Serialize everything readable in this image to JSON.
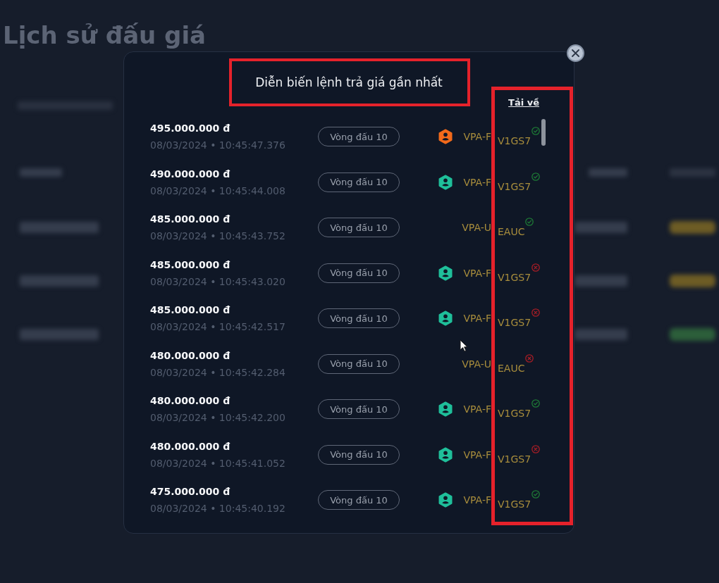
{
  "page": {
    "title": "Lịch sử đấu giá",
    "status_badges": [
      {
        "color": "#6d5c25"
      },
      {
        "color": "#6d5c25"
      },
      {
        "color": "#2c5e3a"
      }
    ]
  },
  "modal": {
    "title": "Diễn biến lệnh trả giá gần nhất",
    "download_link": "Tải về",
    "bids": [
      {
        "price": "495.000.000 đ",
        "time": "08/03/2024 • 10:45:47.376",
        "round": "Vòng đấu 10",
        "avatar": {
          "color": "#f26a1b"
        },
        "code_parts": [
          "VPA-F",
          "V1GS7"
        ],
        "accepted": true
      },
      {
        "price": "490.000.000 đ",
        "time": "08/03/2024 • 10:45:44.008",
        "round": "Vòng đấu 10",
        "avatar": {
          "color": "#1fbf9a"
        },
        "code_parts": [
          "VPA-F",
          "V1GS7"
        ],
        "accepted": true
      },
      {
        "price": "485.000.000 đ",
        "time": "08/03/2024 • 10:45:43.752",
        "round": "Vòng đấu 10",
        "code_parts": [
          "VPA-U",
          "EAUC"
        ],
        "accepted": true
      },
      {
        "price": "485.000.000 đ",
        "time": "08/03/2024 • 10:45:43.020",
        "round": "Vòng đấu 10",
        "avatar": {
          "color": "#1fbf9a"
        },
        "code_parts": [
          "VPA-F",
          "V1GS7"
        ],
        "accepted": false
      },
      {
        "price": "485.000.000 đ",
        "time": "08/03/2024 • 10:45:42.517",
        "round": "Vòng đấu 10",
        "avatar": {
          "color": "#1fbf9a"
        },
        "code_parts": [
          "VPA-F",
          "V1GS7"
        ],
        "accepted": false
      },
      {
        "price": "480.000.000 đ",
        "time": "08/03/2024 • 10:45:42.284",
        "round": "Vòng đấu 10",
        "code_parts": [
          "VPA-U",
          "EAUC"
        ],
        "accepted": false
      },
      {
        "price": "480.000.000 đ",
        "time": "08/03/2024 • 10:45:42.200",
        "round": "Vòng đấu 10",
        "avatar": {
          "color": "#1fbf9a"
        },
        "code_parts": [
          "VPA-F",
          "V1GS7"
        ],
        "accepted": true
      },
      {
        "price": "480.000.000 đ",
        "time": "08/03/2024 • 10:45:41.052",
        "round": "Vòng đấu 10",
        "avatar": {
          "color": "#1fbf9a"
        },
        "code_parts": [
          "VPA-F",
          "V1GS7"
        ],
        "accepted": false
      },
      {
        "price": "475.000.000 đ",
        "time": "08/03/2024 • 10:45:40.192",
        "round": "Vòng đấu 10",
        "avatar": {
          "color": "#1fbf9a"
        },
        "code_parts": [
          "VPA-F",
          "V1GS7"
        ],
        "accepted": true
      }
    ]
  }
}
